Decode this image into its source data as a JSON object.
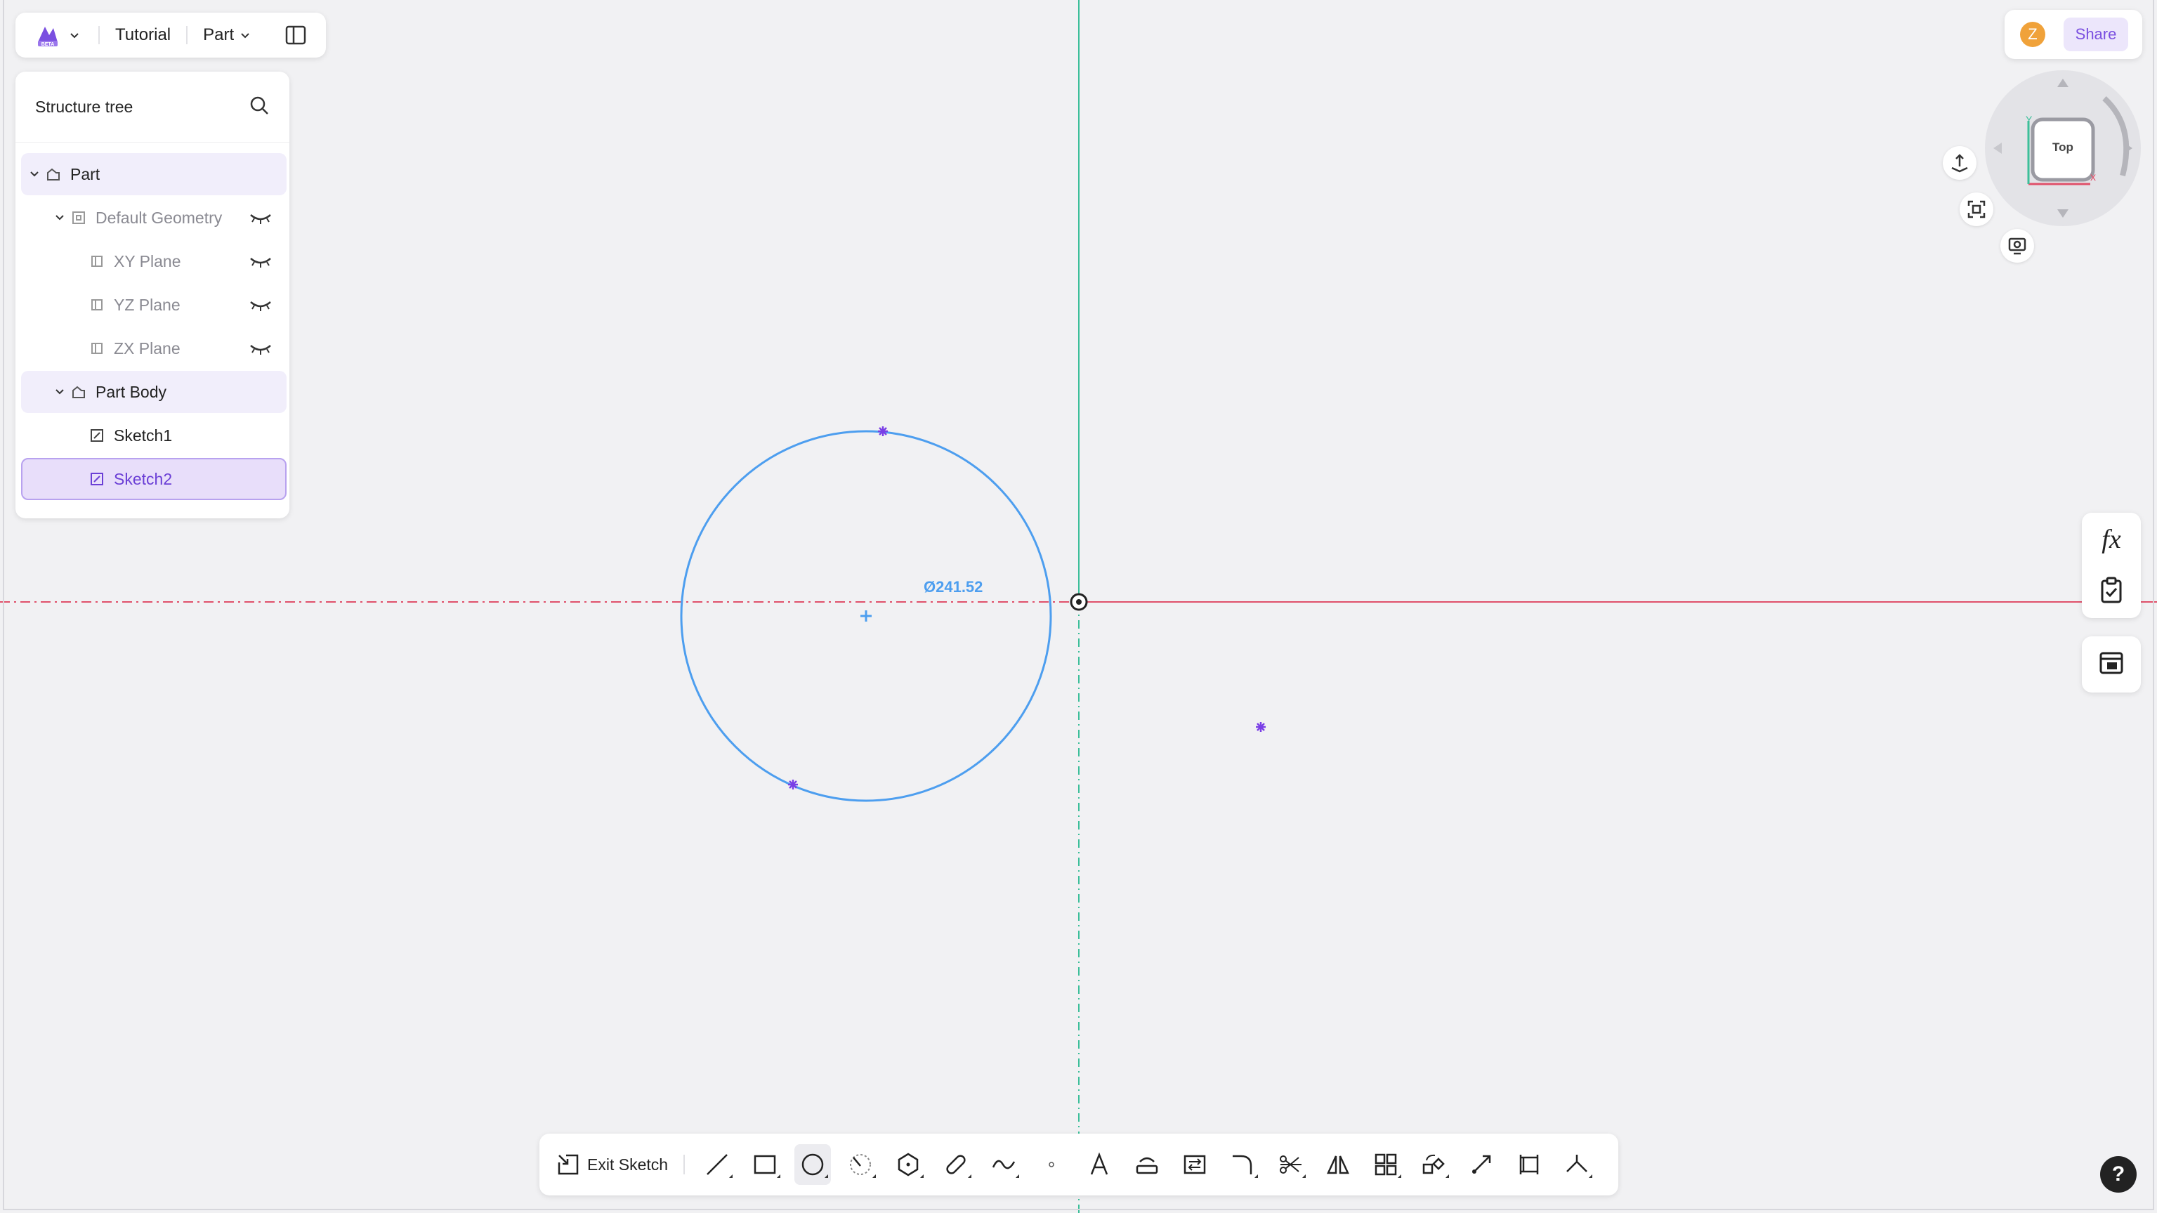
{
  "header": {
    "app_menu_icon": "app-logo",
    "document_name": "Tutorial",
    "mode_label": "Part",
    "layout_toggle_icon": "panel-layout-icon"
  },
  "structure_tree": {
    "title": "Structure tree",
    "search_icon": "search-icon",
    "items": [
      {
        "label": "Part",
        "level": 0,
        "expanded": true,
        "icon": "part-icon"
      },
      {
        "label": "Default Geometry",
        "level": 1,
        "expanded": true,
        "icon": "geometry-icon",
        "visibility": "hidden"
      },
      {
        "label": "XY Plane",
        "level": 2,
        "icon": "plane-icon",
        "visibility": "hidden"
      },
      {
        "label": "YZ Plane",
        "level": 2,
        "icon": "plane-icon",
        "visibility": "hidden"
      },
      {
        "label": "ZX Plane",
        "level": 2,
        "icon": "plane-icon",
        "visibility": "hidden"
      },
      {
        "label": "Part Body",
        "level": 1,
        "expanded": true,
        "icon": "body-icon"
      },
      {
        "label": "Sketch1",
        "level": 2,
        "icon": "sketch-icon"
      },
      {
        "label": "Sketch2",
        "level": 2,
        "icon": "sketch-icon",
        "selected": true
      }
    ]
  },
  "user": {
    "avatar_initial": "Z",
    "share_label": "Share"
  },
  "view_cube": {
    "face_label": "Top",
    "axis_x": "x",
    "axis_y": "Y"
  },
  "sketch": {
    "dimension_label": "Ø241.52"
  },
  "toolbar": {
    "exit_sketch_label": "Exit Sketch",
    "tools": [
      "line-tool",
      "rectangle-tool",
      "circle-tool",
      "arc-tool",
      "polygon-tool",
      "slot-tool",
      "spline-tool",
      "point-tool",
      "text-tool",
      "offset-tool",
      "convert-tool",
      "fillet-tool",
      "trim-tool",
      "mirror-tool",
      "pattern-tool",
      "transform-tool",
      "extend-tool",
      "dimension-tool",
      "constraint-tool"
    ],
    "active_tool": "circle-tool"
  },
  "help": {
    "label": "?"
  },
  "colors": {
    "accent": "#7a4fe0",
    "sketch_blue": "#4d9eef",
    "axis_red": "#e0506a",
    "axis_green": "#3dbf9a",
    "point_purple": "#7a3fe6"
  }
}
